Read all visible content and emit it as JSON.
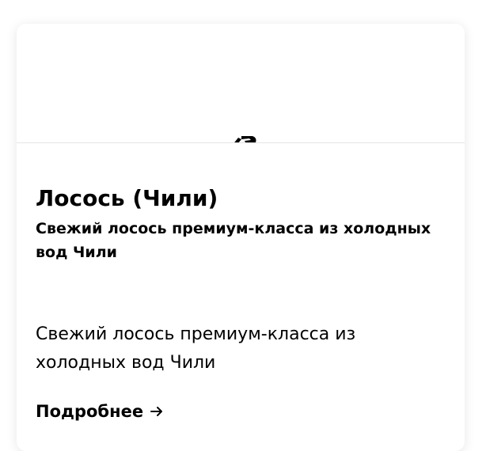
{
  "card": {
    "title": "Лосось (Чили)",
    "subtitle": "Свежий лосось премиум-класса из холодных вод Чили",
    "description": "Свежий лосось премиум-класса из холодных вод Чили",
    "link_label": "Подробнее",
    "link_icon": "arrow-right-icon",
    "media_icon": "fish-icon"
  },
  "colors": {
    "background": "#ffffff",
    "text": "#000000",
    "divider": "#e6e6e6"
  }
}
